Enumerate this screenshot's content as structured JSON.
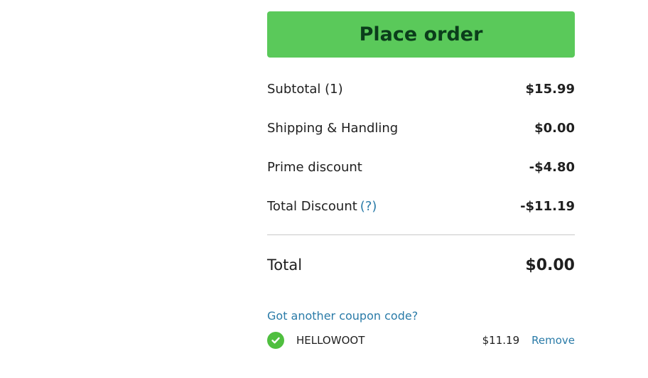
{
  "order": {
    "place_order_label": "Place order"
  },
  "summary": {
    "rows": [
      {
        "label": "Subtotal (1)",
        "value": "$15.99"
      },
      {
        "label": "Shipping & Handling",
        "value": "$0.00"
      },
      {
        "label": "Prime discount",
        "value": "-$4.80"
      },
      {
        "label": "Total Discount",
        "help": "(?)",
        "value": "-$11.19"
      }
    ],
    "total_label": "Total",
    "total_value": "$0.00"
  },
  "coupon": {
    "prompt": "Got another coupon code?",
    "applied": {
      "code": "HELLOWOOT",
      "amount": "$11.19",
      "remove_label": "Remove"
    }
  },
  "colors": {
    "place_order_bg": "#5ac95a",
    "place_order_text": "#0b3d1b",
    "link": "#2a7ba8",
    "check": "#4fbf3f"
  }
}
